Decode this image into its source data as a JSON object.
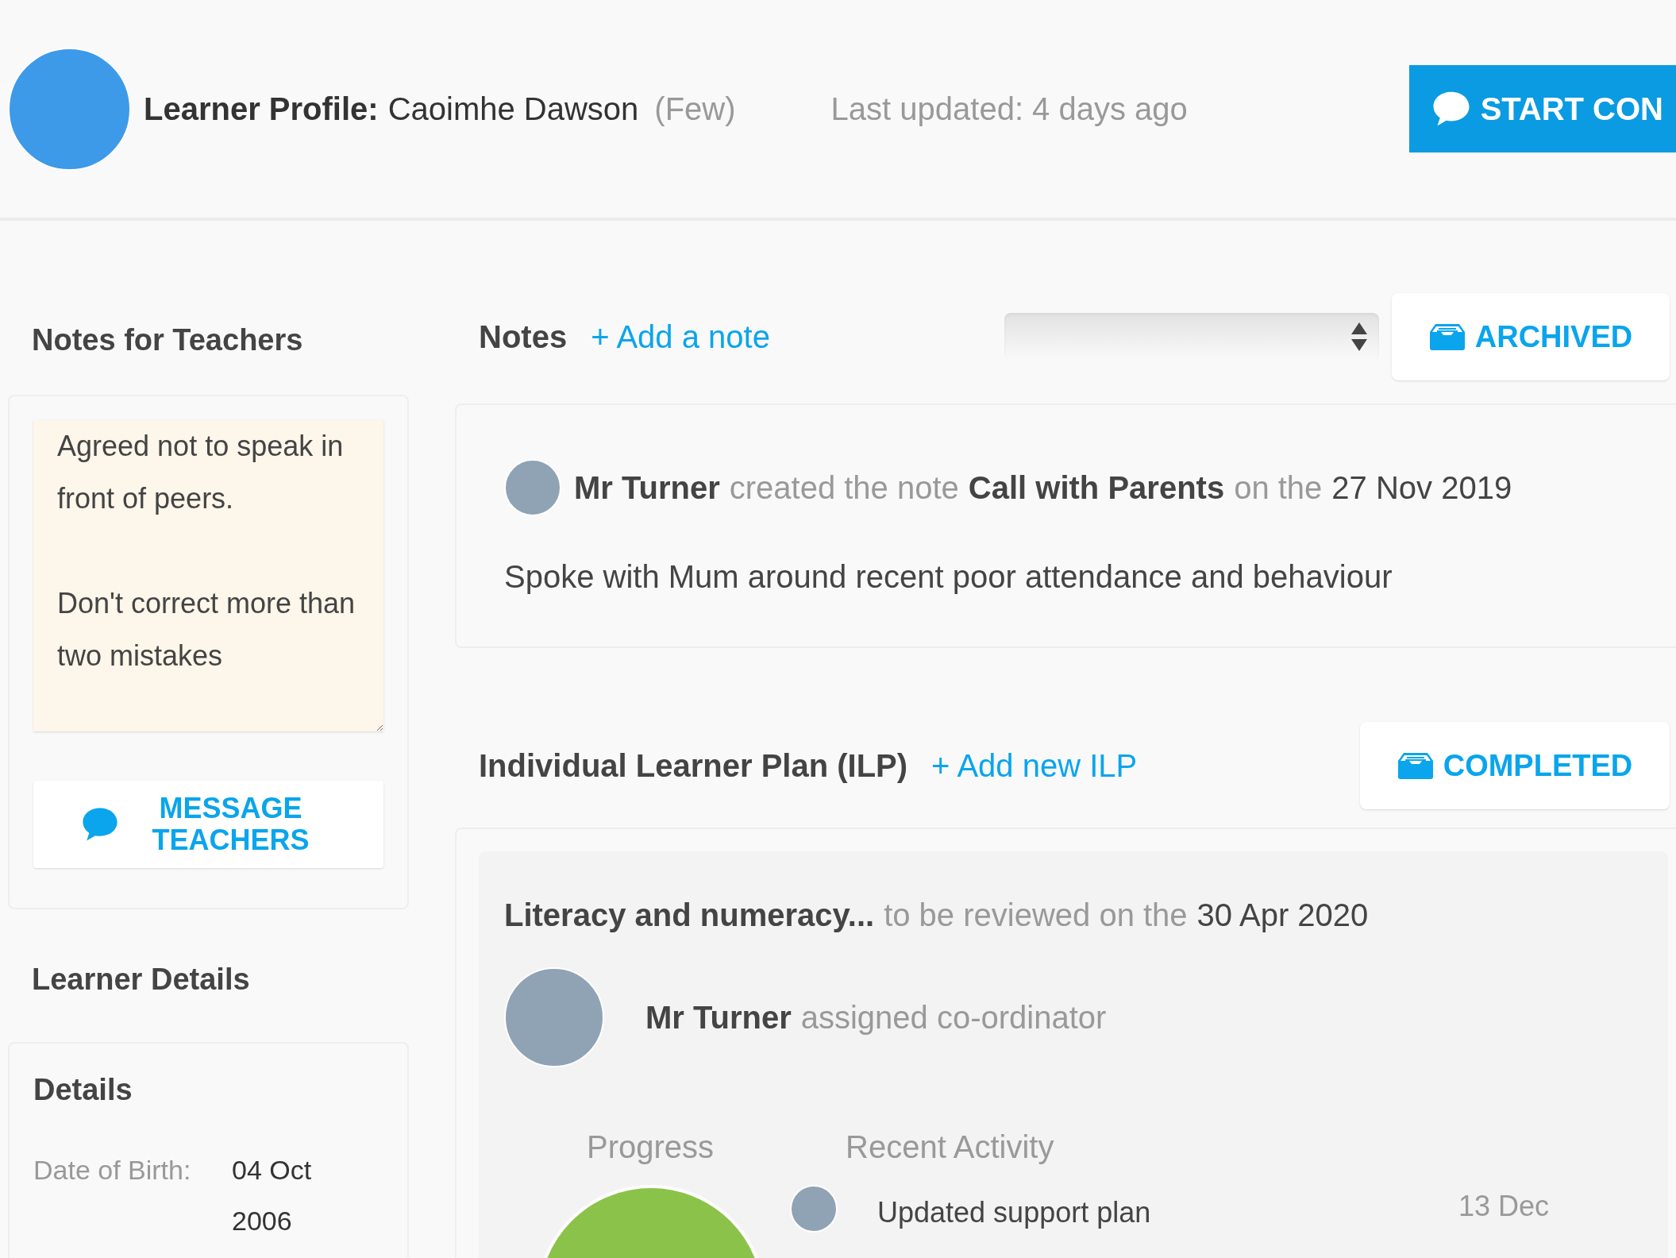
{
  "header": {
    "profile_label": "Learner Profile:",
    "learner_name": "Caoimhe Dawson",
    "group": "(Few)",
    "last_updated": "Last updated: 4 days ago",
    "start_button": "START CON"
  },
  "notes_for_teachers": {
    "title": "Notes for Teachers",
    "notes": "Agreed not to speak in front of peers.\n\nDon't correct more than two mistakes",
    "message_button": "MESSAGE TEACHERS"
  },
  "learner_details": {
    "title": "Learner Details",
    "card_title": "Details",
    "fields": [
      {
        "label": "Date of Birth:",
        "value": "04 Oct 2006"
      }
    ]
  },
  "notes": {
    "title": "Notes",
    "add_link": "+ Add a note",
    "archived_button": "ARCHIVED",
    "items": [
      {
        "author": "Mr Turner",
        "action": "created the note",
        "note_title": "Call with Parents",
        "connector": "on the",
        "date": "27 Nov 2019",
        "body": "Spoke with Mum around recent poor attendance and behaviour"
      }
    ]
  },
  "ilp": {
    "title": "Individual Learner Plan (ILP)",
    "add_link": "+ Add new ILP",
    "completed_button": "COMPLETED",
    "plans": [
      {
        "title": "Literacy and numeracy...",
        "review_text": "to be reviewed on the",
        "review_date": "30 Apr 2020",
        "coordinator": "Mr Turner",
        "coordinator_role": "assigned co-ordinator",
        "progress_label": "Progress",
        "activity_label": "Recent Activity",
        "activity": [
          {
            "text": "Updated support plan",
            "date": "13 Dec"
          }
        ]
      }
    ]
  }
}
